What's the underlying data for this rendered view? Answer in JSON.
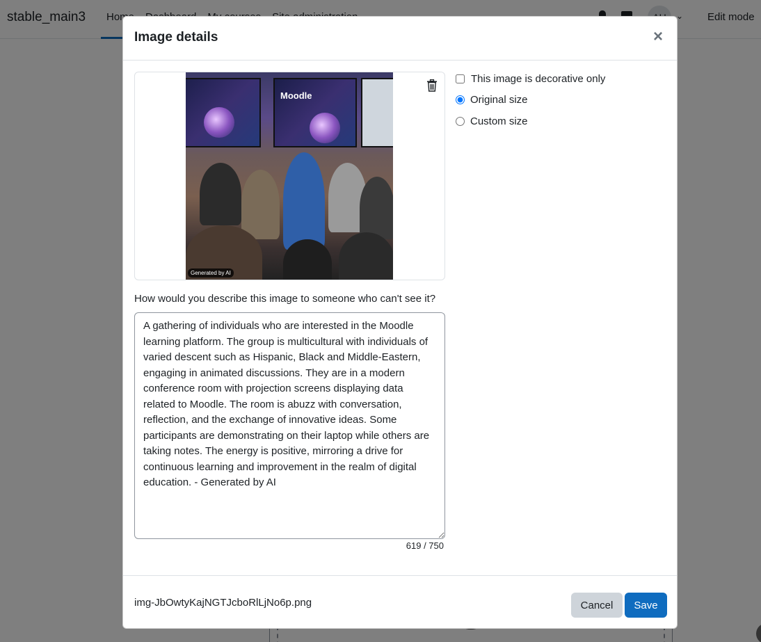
{
  "navbar": {
    "site_name": "stable_main3",
    "links": [
      "Home",
      "Dashboard",
      "My courses",
      "Site administration"
    ],
    "avatar_initials": "AU",
    "edit_mode_label": "Edit mode"
  },
  "modal": {
    "title": "Image details",
    "close_icon": "close-icon",
    "image": {
      "screen_text": "Moodle",
      "badge": "Generated by AI"
    },
    "options": {
      "decorative_label": "This image is decorative only",
      "decorative_checked": false,
      "original_size_label": "Original size",
      "original_size_checked": true,
      "custom_size_label": "Custom size",
      "custom_size_checked": false
    },
    "alt_text": {
      "label": "How would you describe this image to someone who can't see it?",
      "value": "A gathering of individuals who are interested in the Moodle learning platform. The group is multicultural with individuals of varied descent such as Hispanic, Black and Middle-Eastern, engaging in animated discussions. They are in a modern conference room with projection screens displaying data related to Moodle. The room is abuzz with conversation, reflection, and the exchange of innovative ideas. Some participants are demonstrating on their laptop while others are taking notes. The energy is positive, mirroring a drive for continuous learning and improvement in the realm of digital education. - Generated by AI",
      "char_count": "619 / 750"
    },
    "footer": {
      "filename": "img-JbOwtyKajNGTJcboRlLjNo6p.png",
      "cancel_label": "Cancel",
      "save_label": "Save"
    }
  },
  "colors": {
    "primary": "#0f6cbf",
    "secondary": "#ced4da",
    "backdrop": "rgba(0,0,0,0.5)"
  }
}
